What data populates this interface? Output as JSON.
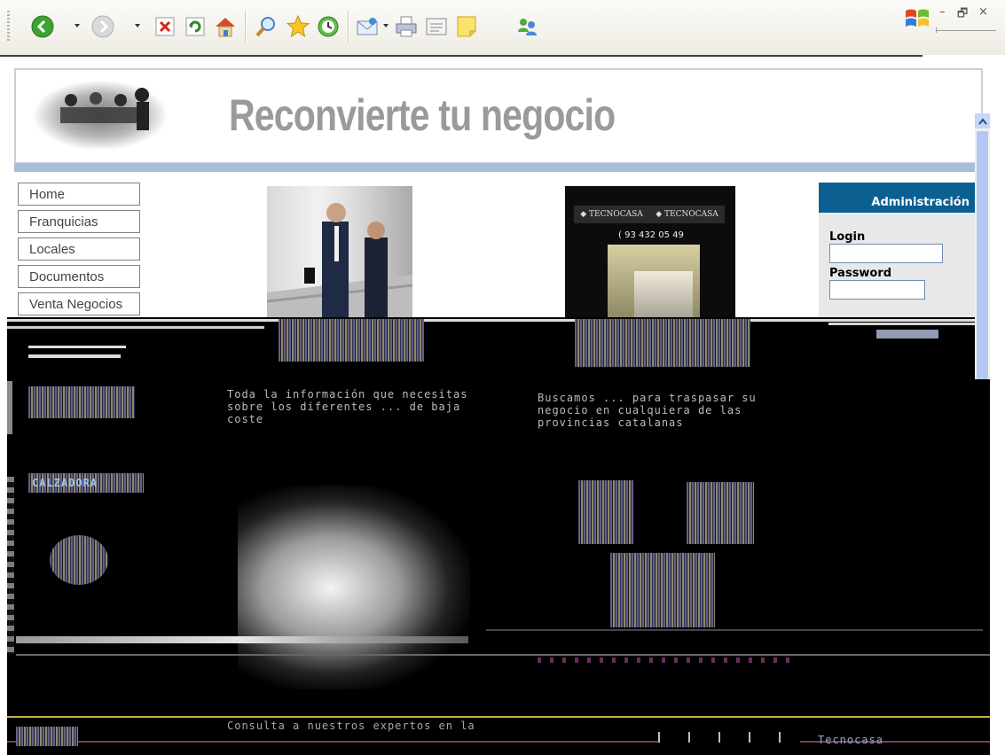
{
  "toolbar": {
    "buttons": [
      {
        "name": "back",
        "icon": "back-arrow-icon"
      },
      {
        "name": "forward",
        "icon": "forward-arrow-icon"
      },
      {
        "name": "stop",
        "icon": "stop-icon"
      },
      {
        "name": "refresh",
        "icon": "refresh-icon"
      },
      {
        "name": "home",
        "icon": "home-icon"
      },
      {
        "name": "search",
        "icon": "search-icon"
      },
      {
        "name": "favorites",
        "icon": "star-icon"
      },
      {
        "name": "history",
        "icon": "history-icon"
      },
      {
        "name": "mail",
        "icon": "mail-icon"
      },
      {
        "name": "print",
        "icon": "print-icon"
      },
      {
        "name": "edit",
        "icon": "edit-icon"
      },
      {
        "name": "discuss",
        "icon": "note-icon"
      },
      {
        "name": "messenger",
        "icon": "messenger-icon"
      }
    ],
    "window_controls": {
      "minimize": "–",
      "restore": "🗗",
      "close": "×"
    }
  },
  "header": {
    "title": "Reconvierte tu negocio"
  },
  "menu": {
    "items": [
      "Home",
      "Franquicias",
      "Locales",
      "Documentos",
      "Venta Negocios"
    ]
  },
  "storefront": {
    "sign_left": "◆ TECNOCASA",
    "sign_right": "◆ TECNOCASA",
    "phone": "( 93 432 05 49"
  },
  "admin": {
    "title": "Administración",
    "login_label": "Login",
    "password_label": "Password",
    "login_value": "",
    "password_value": ""
  },
  "glitched": {
    "left_heading": "CALZADORA",
    "mid_text": "Toda la información que necesitas sobre los diferentes ... de baja coste",
    "right_text": "Buscamos ... para traspasar su negocio en cualquiera de las provincias catalanas",
    "bottom_text": "Consulta a nuestros expertos en la",
    "bottom_right_brand": "Tecnocasa"
  },
  "colors": {
    "admin_header": "#0b5f91",
    "header_bar": "#a8bdd6",
    "title_gray": "#9a9a9a"
  }
}
